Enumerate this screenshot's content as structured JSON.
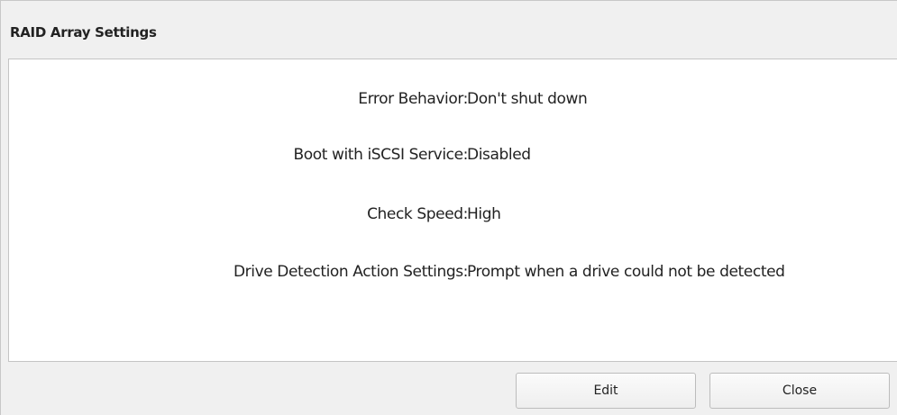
{
  "dialog": {
    "title": "RAID Array Settings"
  },
  "settings": [
    {
      "label": "Error Behavior:",
      "value": "Don't shut down"
    },
    {
      "label": "Boot with iSCSI Service:",
      "value": "Disabled"
    },
    {
      "label": "Check Speed:",
      "value": "High"
    },
    {
      "label": "Drive Detection Action Settings:",
      "value": "Prompt when a drive could not be detected"
    }
  ],
  "buttons": {
    "edit_label": "Edit",
    "close_label": "Close"
  }
}
